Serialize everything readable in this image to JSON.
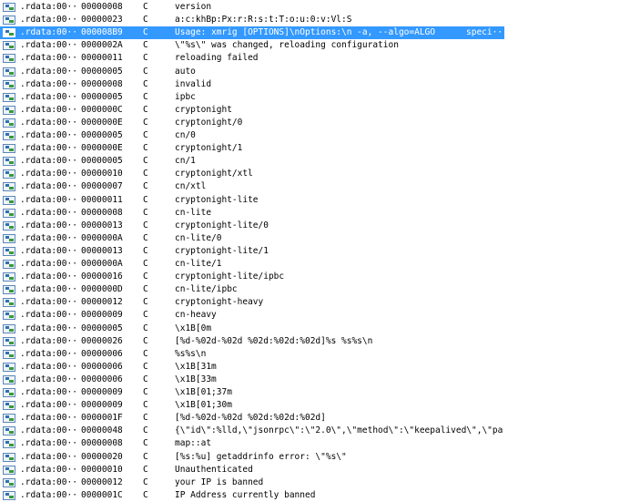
{
  "selected_index": 2,
  "rows": [
    {
      "section": ".rdata:00···",
      "length": "00000008",
      "type": "C",
      "string": "version"
    },
    {
      "section": ".rdata:00···",
      "length": "00000023",
      "type": "C",
      "string": "a:c:khBp:Px:r:R:s:t:T:o:u:0:v:Vl:S"
    },
    {
      "section": ".rdata:00···",
      "length": "000008B9",
      "type": "C",
      "string": "Usage: xmrig [OPTIONS]\\nOptions:\\n  -a, --algo=ALGO",
      "string_tail": "speci···"
    },
    {
      "section": ".rdata:00···",
      "length": "0000002A",
      "type": "C",
      "string": "\\\"%s\\\" was changed, reloading configuration"
    },
    {
      "section": ".rdata:00···",
      "length": "00000011",
      "type": "C",
      "string": "reloading failed"
    },
    {
      "section": ".rdata:00···",
      "length": "00000005",
      "type": "C",
      "string": "auto"
    },
    {
      "section": ".rdata:00···",
      "length": "00000008",
      "type": "C",
      "string": "invalid"
    },
    {
      "section": ".rdata:00···",
      "length": "00000005",
      "type": "C",
      "string": "ipbc"
    },
    {
      "section": ".rdata:00···",
      "length": "0000000C",
      "type": "C",
      "string": "cryptonight"
    },
    {
      "section": ".rdata:00···",
      "length": "0000000E",
      "type": "C",
      "string": "cryptonight/0"
    },
    {
      "section": ".rdata:00···",
      "length": "00000005",
      "type": "C",
      "string": "cn/0"
    },
    {
      "section": ".rdata:00···",
      "length": "0000000E",
      "type": "C",
      "string": "cryptonight/1"
    },
    {
      "section": ".rdata:00···",
      "length": "00000005",
      "type": "C",
      "string": "cn/1"
    },
    {
      "section": ".rdata:00···",
      "length": "00000010",
      "type": "C",
      "string": "cryptonight/xtl"
    },
    {
      "section": ".rdata:00···",
      "length": "00000007",
      "type": "C",
      "string": "cn/xtl"
    },
    {
      "section": ".rdata:00···",
      "length": "00000011",
      "type": "C",
      "string": "cryptonight-lite"
    },
    {
      "section": ".rdata:00···",
      "length": "00000008",
      "type": "C",
      "string": "cn-lite"
    },
    {
      "section": ".rdata:00···",
      "length": "00000013",
      "type": "C",
      "string": "cryptonight-lite/0"
    },
    {
      "section": ".rdata:00···",
      "length": "0000000A",
      "type": "C",
      "string": "cn-lite/0"
    },
    {
      "section": ".rdata:00···",
      "length": "00000013",
      "type": "C",
      "string": "cryptonight-lite/1"
    },
    {
      "section": ".rdata:00···",
      "length": "0000000A",
      "type": "C",
      "string": "cn-lite/1"
    },
    {
      "section": ".rdata:00···",
      "length": "00000016",
      "type": "C",
      "string": "cryptonight-lite/ipbc"
    },
    {
      "section": ".rdata:00···",
      "length": "0000000D",
      "type": "C",
      "string": "cn-lite/ipbc"
    },
    {
      "section": ".rdata:00···",
      "length": "00000012",
      "type": "C",
      "string": "cryptonight-heavy"
    },
    {
      "section": ".rdata:00···",
      "length": "00000009",
      "type": "C",
      "string": "cn-heavy"
    },
    {
      "section": ".rdata:00···",
      "length": "00000005",
      "type": "C",
      "string": "\\x1B[0m"
    },
    {
      "section": ".rdata:00···",
      "length": "00000026",
      "type": "C",
      "string": "[%d-%02d-%02d %02d:%02d:%02d]%s %s%s\\n"
    },
    {
      "section": ".rdata:00···",
      "length": "00000006",
      "type": "C",
      "string": "%s%s\\n"
    },
    {
      "section": ".rdata:00···",
      "length": "00000006",
      "type": "C",
      "string": "\\x1B[31m"
    },
    {
      "section": ".rdata:00···",
      "length": "00000006",
      "type": "C",
      "string": "\\x1B[33m"
    },
    {
      "section": ".rdata:00···",
      "length": "00000009",
      "type": "C",
      "string": "\\x1B[01;37m"
    },
    {
      "section": ".rdata:00···",
      "length": "00000009",
      "type": "C",
      "string": "\\x1B[01;30m"
    },
    {
      "section": ".rdata:00···",
      "length": "0000001F",
      "type": "C",
      "string": "[%d-%02d-%02d %02d:%02d:%02d]"
    },
    {
      "section": ".rdata:00···",
      "length": "00000048",
      "type": "C",
      "string": "{\\\"id\\\":%lld,\\\"jsonrpc\\\":\\\"2.0\\\",\\\"method\\\":\\\"keepalived\\\",\\\"param···"
    },
    {
      "section": ".rdata:00···",
      "length": "00000008",
      "type": "C",
      "string": "map::at"
    },
    {
      "section": ".rdata:00···",
      "length": "00000020",
      "type": "C",
      "string": "[%s:%u] getaddrinfo error: \\\"%s\\\""
    },
    {
      "section": ".rdata:00···",
      "length": "00000010",
      "type": "C",
      "string": "Unauthenticated"
    },
    {
      "section": ".rdata:00···",
      "length": "00000012",
      "type": "C",
      "string": "your IP is banned"
    },
    {
      "section": ".rdata:00···",
      "length": "0000001C",
      "type": "C",
      "string": "IP Address currently banned"
    }
  ]
}
